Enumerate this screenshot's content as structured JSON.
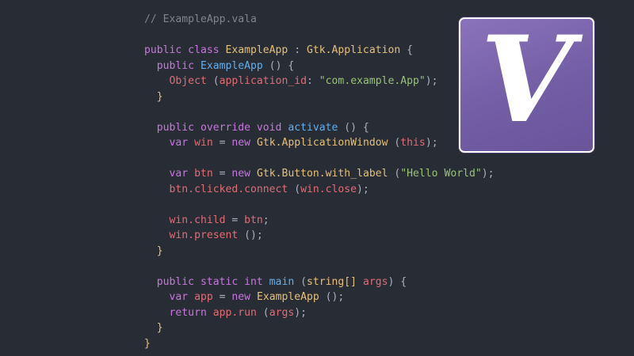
{
  "colors": {
    "background": "#282c34",
    "comment": "#7f848e",
    "keyword": "#c678dd",
    "type": "#e5c07b",
    "function": "#61afef",
    "variable": "#e06c75",
    "string": "#98c379",
    "punctuation": "#abb2bf",
    "logo_purple": "#725ea5"
  },
  "logo": {
    "letter": "V"
  },
  "code_lines": [
    [
      {
        "t": "// ExampleApp.vala",
        "c": "comment"
      }
    ],
    [],
    [
      {
        "t": "public class ",
        "c": "keyword"
      },
      {
        "t": "ExampleApp",
        "c": "type"
      },
      {
        "t": " : ",
        "c": "punctuation"
      },
      {
        "t": "Gtk.Application",
        "c": "type"
      },
      {
        "t": " {",
        "c": "punctuation"
      }
    ],
    [
      {
        "t": "  public ",
        "c": "keyword"
      },
      {
        "t": "ExampleApp",
        "c": "function"
      },
      {
        "t": " () {",
        "c": "punctuation"
      }
    ],
    [
      {
        "t": "    Object",
        "c": "variable"
      },
      {
        "t": " (",
        "c": "punctuation"
      },
      {
        "t": "application_id",
        "c": "variable"
      },
      {
        "t": ": ",
        "c": "punctuation"
      },
      {
        "t": "\"com.example.App\"",
        "c": "string"
      },
      {
        "t": ");",
        "c": "punctuation"
      }
    ],
    [
      {
        "t": "  }",
        "c": "type"
      }
    ],
    [],
    [
      {
        "t": "  public override void ",
        "c": "keyword"
      },
      {
        "t": "activate",
        "c": "function"
      },
      {
        "t": " () {",
        "c": "punctuation"
      }
    ],
    [
      {
        "t": "    var ",
        "c": "keyword"
      },
      {
        "t": "win",
        "c": "variable"
      },
      {
        "t": " = ",
        "c": "punctuation"
      },
      {
        "t": "new ",
        "c": "keyword"
      },
      {
        "t": "Gtk.ApplicationWindow",
        "c": "type"
      },
      {
        "t": " (",
        "c": "punctuation"
      },
      {
        "t": "this",
        "c": "variable"
      },
      {
        "t": ");",
        "c": "punctuation"
      }
    ],
    [],
    [
      {
        "t": "    var ",
        "c": "keyword"
      },
      {
        "t": "btn",
        "c": "variable"
      },
      {
        "t": " = ",
        "c": "punctuation"
      },
      {
        "t": "new ",
        "c": "keyword"
      },
      {
        "t": "Gtk.Button.with_label",
        "c": "type"
      },
      {
        "t": " (",
        "c": "punctuation"
      },
      {
        "t": "\"Hello World\"",
        "c": "string"
      },
      {
        "t": ");",
        "c": "punctuation"
      }
    ],
    [
      {
        "t": "    btn.clicked.connect",
        "c": "variable"
      },
      {
        "t": " (",
        "c": "punctuation"
      },
      {
        "t": "win.close",
        "c": "variable"
      },
      {
        "t": ");",
        "c": "punctuation"
      }
    ],
    [],
    [
      {
        "t": "    win.child",
        "c": "variable"
      },
      {
        "t": " = ",
        "c": "punctuation"
      },
      {
        "t": "btn",
        "c": "variable"
      },
      {
        "t": ";",
        "c": "punctuation"
      }
    ],
    [
      {
        "t": "    win.present",
        "c": "variable"
      },
      {
        "t": " ();",
        "c": "punctuation"
      }
    ],
    [
      {
        "t": "  }",
        "c": "type"
      }
    ],
    [],
    [
      {
        "t": "  public static int ",
        "c": "keyword"
      },
      {
        "t": "main",
        "c": "function"
      },
      {
        "t": " (",
        "c": "punctuation"
      },
      {
        "t": "string[]",
        "c": "type"
      },
      {
        "t": " ",
        "c": "punctuation"
      },
      {
        "t": "args",
        "c": "variable"
      },
      {
        "t": ") {",
        "c": "punctuation"
      }
    ],
    [
      {
        "t": "    var ",
        "c": "keyword"
      },
      {
        "t": "app",
        "c": "variable"
      },
      {
        "t": " = ",
        "c": "punctuation"
      },
      {
        "t": "new ",
        "c": "keyword"
      },
      {
        "t": "ExampleApp",
        "c": "type"
      },
      {
        "t": " ();",
        "c": "punctuation"
      }
    ],
    [
      {
        "t": "    return ",
        "c": "keyword"
      },
      {
        "t": "app.run",
        "c": "variable"
      },
      {
        "t": " (",
        "c": "punctuation"
      },
      {
        "t": "args",
        "c": "variable"
      },
      {
        "t": ");",
        "c": "punctuation"
      }
    ],
    [
      {
        "t": "  }",
        "c": "type"
      }
    ],
    [
      {
        "t": "}",
        "c": "type"
      }
    ]
  ]
}
